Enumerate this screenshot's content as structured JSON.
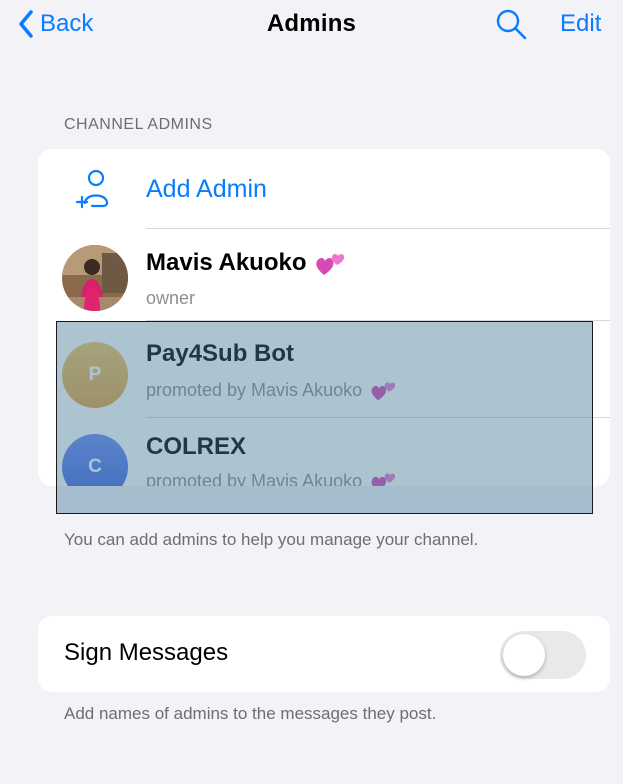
{
  "navbar": {
    "back_label": "Back",
    "title": "Admins",
    "edit_label": "Edit",
    "search_icon": "search-icon"
  },
  "section": {
    "header": "CHANNEL ADMINS"
  },
  "add_admin": {
    "label": "Add Admin",
    "icon": "add-person-icon"
  },
  "admins": [
    {
      "name": "Mavis Akuoko",
      "subtitle": "owner",
      "avatar": "photo",
      "emoji": "two-hearts"
    },
    {
      "name": "Pay4Sub Bot",
      "subtitle": "promoted by Mavis Akuoko",
      "avatar_letter": "P",
      "avatar_color": "#f0b450",
      "emoji": "two-hearts"
    },
    {
      "name": "COLREX",
      "subtitle": "promoted by Mavis Akuoko",
      "avatar_letter": "C",
      "avatar_color": "#4f72e8",
      "emoji": "two-hearts"
    }
  ],
  "footer_note": "You can add admins to help you manage your channel.",
  "sign_messages": {
    "label": "Sign Messages",
    "enabled": false,
    "note": "Add names of admins to the messages they post."
  },
  "colors": {
    "accent": "#0a7cff",
    "background": "#f2f2f7",
    "highlight": "#487c96"
  }
}
